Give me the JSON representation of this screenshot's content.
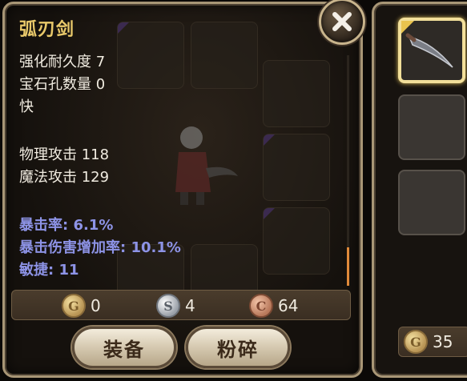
{
  "item": {
    "name": "弧刃剑",
    "durability": "强化耐久度 7",
    "sockets": "宝石孔数量 0",
    "speed": "快",
    "physical_attack": "物理攻击 118",
    "magic_attack": "魔法攻击 129",
    "bonuses": [
      "暴击率: 6.1%",
      "暴击伤害增加率: 10.1%",
      "敏捷: 11"
    ]
  },
  "price": {
    "gold": "0",
    "silver": "4",
    "copper": "64"
  },
  "buttons": {
    "equip": "装备",
    "smash": "粉碎"
  },
  "side": {
    "coin_amount": "35"
  },
  "icons": {
    "close": "close-icon",
    "gold": "gold-coin-icon",
    "silver": "silver-coin-icon",
    "copper": "copper-coin-icon"
  },
  "colors": {
    "title": "#e9c96a",
    "bonus_text": "#8d93e6",
    "frame": "#a89676"
  }
}
